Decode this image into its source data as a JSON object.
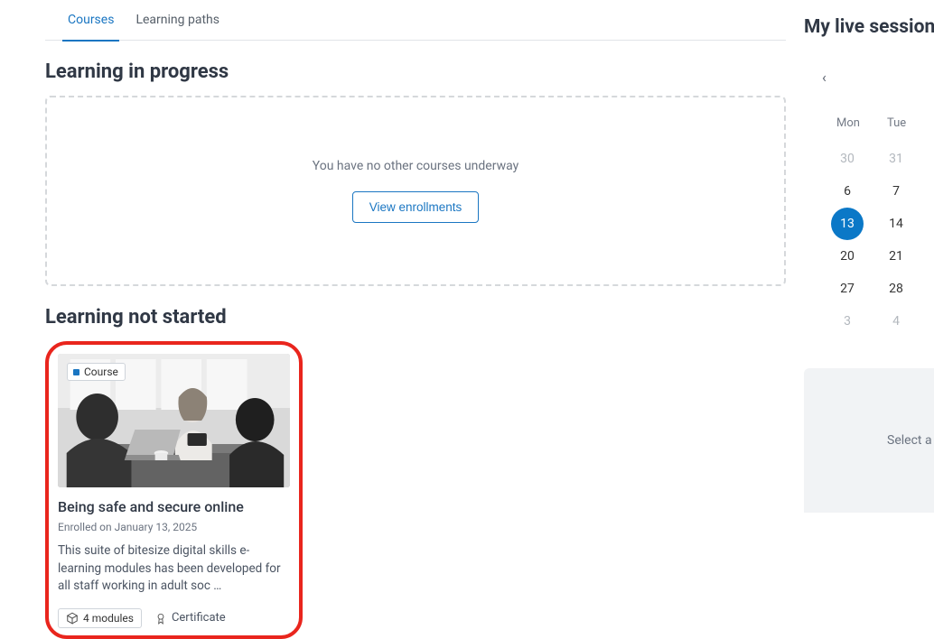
{
  "tabs": {
    "courses": "Courses",
    "paths": "Learning paths"
  },
  "sections": {
    "inprogress_title": "Learning in progress",
    "notstarted_title": "Learning not started",
    "empty_msg": "You have no other courses underway",
    "view_enrollments": "View enrollments"
  },
  "card": {
    "badge": "Course",
    "title": "Being safe and secure online",
    "sub": "Enrolled on January 13, 2025",
    "desc": "This suite of bitesize digital skills e-learning modules has been developed for all staff working in adult soc …",
    "modules": "4 modules",
    "certificate": "Certificate"
  },
  "sidebar": {
    "title": "My live session",
    "select_text": "Select a",
    "days": [
      "Mon",
      "Tue"
    ],
    "grid": [
      [
        {
          "n": "30",
          "dim": true
        },
        {
          "n": "31",
          "dim": true
        }
      ],
      [
        {
          "n": "6"
        },
        {
          "n": "7"
        }
      ],
      [
        {
          "n": "13",
          "selected": true
        },
        {
          "n": "14"
        }
      ],
      [
        {
          "n": "20"
        },
        {
          "n": "21"
        }
      ],
      [
        {
          "n": "27"
        },
        {
          "n": "28"
        }
      ],
      [
        {
          "n": "3",
          "dim": true
        },
        {
          "n": "4",
          "dim": true
        }
      ]
    ]
  }
}
